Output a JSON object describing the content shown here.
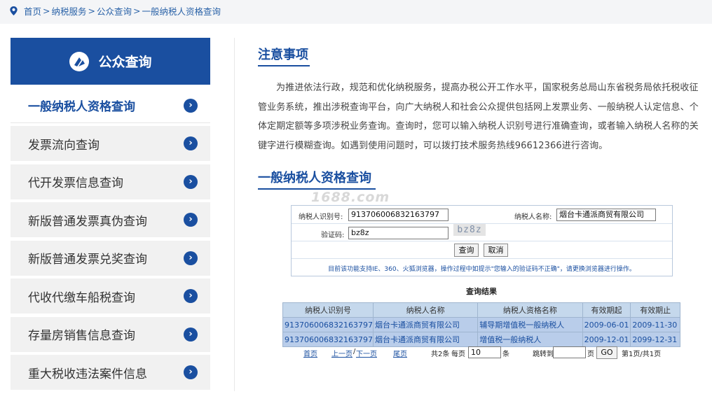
{
  "breadcrumb": {
    "items": [
      "首页",
      "纳税服务",
      "公众查询",
      "一般纳税人资格查询"
    ],
    "separator": ">"
  },
  "sidebar": {
    "title": "公众查询",
    "items": [
      {
        "label": "一般纳税人资格查询",
        "active": true
      },
      {
        "label": "发票流向查询"
      },
      {
        "label": "代开发票信息查询"
      },
      {
        "label": "新版普通发票真伪查询"
      },
      {
        "label": "新版普通发票兑奖查询"
      },
      {
        "label": "代收代缴车船税查询"
      },
      {
        "label": "存量房销售信息查询"
      },
      {
        "label": "重大税收违法案件信息"
      }
    ]
  },
  "notice": {
    "title": "注意事项",
    "text": "为推进依法行政，规范和优化纳税服务，提高办税公开工作水平，国家税务总局山东省税务局依托税收征管业务系统，推出涉税查询平台，向广大纳税人和社会公众提供包括网上发票业务、一般纳税人认定信息、个体定期定额等多项涉税业务查询。查询时，您可以输入纳税人识别号进行准确查询，或者输入纳税人名称的关键字进行模糊查询。如遇到使用问题时，可以拨打技术服务热线96612366进行咨询。"
  },
  "query": {
    "title": "一般纳税人资格查询",
    "watermark": "1688.com",
    "id_label": "纳税人识别号:",
    "id_value": "913706006832163797",
    "name_label": "纳税人名称:",
    "name_value": "烟台卡通派商贸有限公司",
    "captcha_label": "验证码:",
    "captcha_value": "bz8z",
    "captcha_image_text": "bz8z",
    "search_button": "查询",
    "cancel_button": "取消",
    "tip": "目前该功能支持IE、360、火狐浏览器，操作过程中如提示\"您输入的验证码不正确\"，请更换浏览器进行操作。"
  },
  "results": {
    "title": "查询结果",
    "headers": [
      "纳税人识别号",
      "纳税人名称",
      "纳税人资格名称",
      "有效期起",
      "有效期止"
    ],
    "rows": [
      [
        "913706006832163797",
        "烟台卡通派商贸有限公司",
        "辅导期增值税一般纳税人",
        "2009-06-01",
        "2009-11-30"
      ],
      [
        "913706006832163797",
        "烟台卡通派商贸有限公司",
        "增值税一般纳税人",
        "2009-12-01",
        "2099-12-31"
      ]
    ]
  },
  "pager": {
    "first": "首页",
    "prev": "上一页",
    "slash": "/",
    "next": "下一页",
    "last": "尾页",
    "total": "共2条",
    "per_page_label": "每页",
    "per_page_value": "10",
    "per_page_unit": "条",
    "jump_label": "跳转到",
    "page_unit": "页",
    "go": "GO",
    "status": "第1页/共1页"
  },
  "colors": {
    "brand": "#1a4fa0",
    "table_header": "#c5d8ec",
    "table_row": "#b9cdea"
  }
}
